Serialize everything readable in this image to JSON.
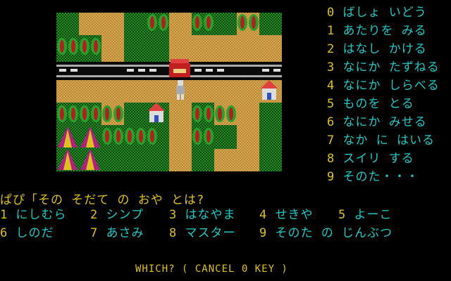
{
  "map": {
    "description_icons": [
      "tree-icon",
      "house-icon",
      "tent-icon",
      "railway-icon",
      "player-icon"
    ],
    "colors": {
      "grass": "#1a6a1a",
      "path": "#c89a40",
      "tree_green": "#2a9a2a",
      "tree_red": "#b02020",
      "rail": "#bbbbbb"
    }
  },
  "commands": [
    {
      "num": "0",
      "label": "ばしょ いどう"
    },
    {
      "num": "1",
      "label": "あたりを みる"
    },
    {
      "num": "2",
      "label": "はなし かける"
    },
    {
      "num": "3",
      "label": "なにか たずねる"
    },
    {
      "num": "4",
      "label": "なにか しらべる"
    },
    {
      "num": "5",
      "label": "ものを とる"
    },
    {
      "num": "6",
      "label": "なにか みせる"
    },
    {
      "num": "7",
      "label": "なか に はいる"
    },
    {
      "num": "8",
      "label": "スイリ する"
    },
    {
      "num": "9",
      "label": "そのた・・・"
    }
  ],
  "prompt": "ぱぴ「その そだて の おや とは?",
  "choices_row1": [
    {
      "num": "1",
      "label": "にしむら"
    },
    {
      "num": "2",
      "label": "シンプ"
    },
    {
      "num": "3",
      "label": "はなやま"
    },
    {
      "num": "4",
      "label": "せきや"
    },
    {
      "num": "5",
      "label": "よーこ"
    }
  ],
  "choices_row2": [
    {
      "num": "6",
      "label": "しのだ"
    },
    {
      "num": "7",
      "label": "あさみ"
    },
    {
      "num": "8",
      "label": "マスター"
    },
    {
      "num": "9",
      "label": "そのた の じんぶつ"
    }
  ],
  "footer": "WHICH? ( CANCEL 0 KEY )"
}
